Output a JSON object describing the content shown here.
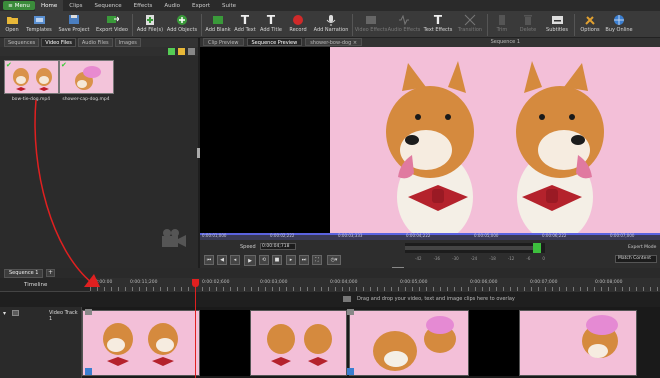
{
  "menubar": {
    "menu_label": "Menu",
    "tabs": [
      "Home",
      "Clips",
      "Sequence",
      "Effects",
      "Audio",
      "Export",
      "Suite"
    ]
  },
  "toolbar": {
    "items": [
      {
        "label": "Open",
        "icon": "folder-open-icon"
      },
      {
        "label": "Templates",
        "icon": "template-icon"
      },
      {
        "label": "Save Project",
        "icon": "save-icon"
      },
      {
        "label": "Export Video",
        "icon": "export-video-icon"
      },
      {
        "label": "Add File(s)",
        "icon": "add-file-icon"
      },
      {
        "label": "Add Objects",
        "icon": "add-objects-icon"
      },
      {
        "label": "Add Blank",
        "icon": "add-blank-icon"
      },
      {
        "label": "Add Text",
        "icon": "add-text-icon"
      },
      {
        "label": "Add Title",
        "icon": "add-title-icon"
      },
      {
        "label": "Record",
        "icon": "record-icon"
      },
      {
        "label": "Add Narration",
        "icon": "microphone-icon"
      },
      {
        "label": "Video Effects",
        "icon": "video-effects-icon"
      },
      {
        "label": "Audio Effects",
        "icon": "audio-effects-icon"
      },
      {
        "label": "Text Effects",
        "icon": "text-effects-icon"
      },
      {
        "label": "Transition",
        "icon": "transition-icon"
      },
      {
        "label": "Trim",
        "icon": "trim-icon"
      },
      {
        "label": "Delete",
        "icon": "delete-icon"
      },
      {
        "label": "Subtitles",
        "icon": "subtitles-icon"
      },
      {
        "label": "Options",
        "icon": "options-icon"
      },
      {
        "label": "Buy Online",
        "icon": "buy-online-icon"
      }
    ]
  },
  "bin": {
    "tabs": [
      "Sequences",
      "Video Files",
      "Audio Files",
      "Images"
    ],
    "files": [
      {
        "name": "bow-tie-dog.mp4"
      },
      {
        "name": "shower-cap-dog.mp4"
      }
    ]
  },
  "preview": {
    "tabs": [
      "Clip Preview",
      "Sequence Preview",
      "shower-bow-dog"
    ],
    "sequence_title": "Sequence 1",
    "ruler_ticks": [
      "0:00:01;000",
      "0:00:02;222",
      "0:00:03;333",
      "0:00:04;222",
      "0:00:05;000",
      "0:00:06;222",
      "0:00:07;000"
    ],
    "speed_label": "Speed",
    "speed_value": "0:00:04;718",
    "expert_mode": "Expert Mode",
    "match_content": "Match Content",
    "vu_labels": [
      "-42",
      "-36",
      "-30",
      "-24",
      "-18",
      "-12",
      "-6",
      "0"
    ]
  },
  "timeline": {
    "tab": "Sequence 1",
    "add_tab": "+",
    "label": "Timeline",
    "ticks": [
      "0:00:00",
      "0:00:11;200",
      "0:00:02;600",
      "0:00:03;000",
      "0:00:04;000",
      "0:00:05;000",
      "0:00:06;000",
      "0:00:07;000",
      "0:00:08;000"
    ],
    "overlay_hint": "Drag and drop your video, text and image clips here to overlay",
    "video_track": "Video Track 1"
  },
  "colors": {
    "accent_green": "#3b8c3b",
    "playhead_red": "#e02020",
    "ruler_blue": "#4a52d8",
    "clip_pink": "#f3bfd8"
  }
}
